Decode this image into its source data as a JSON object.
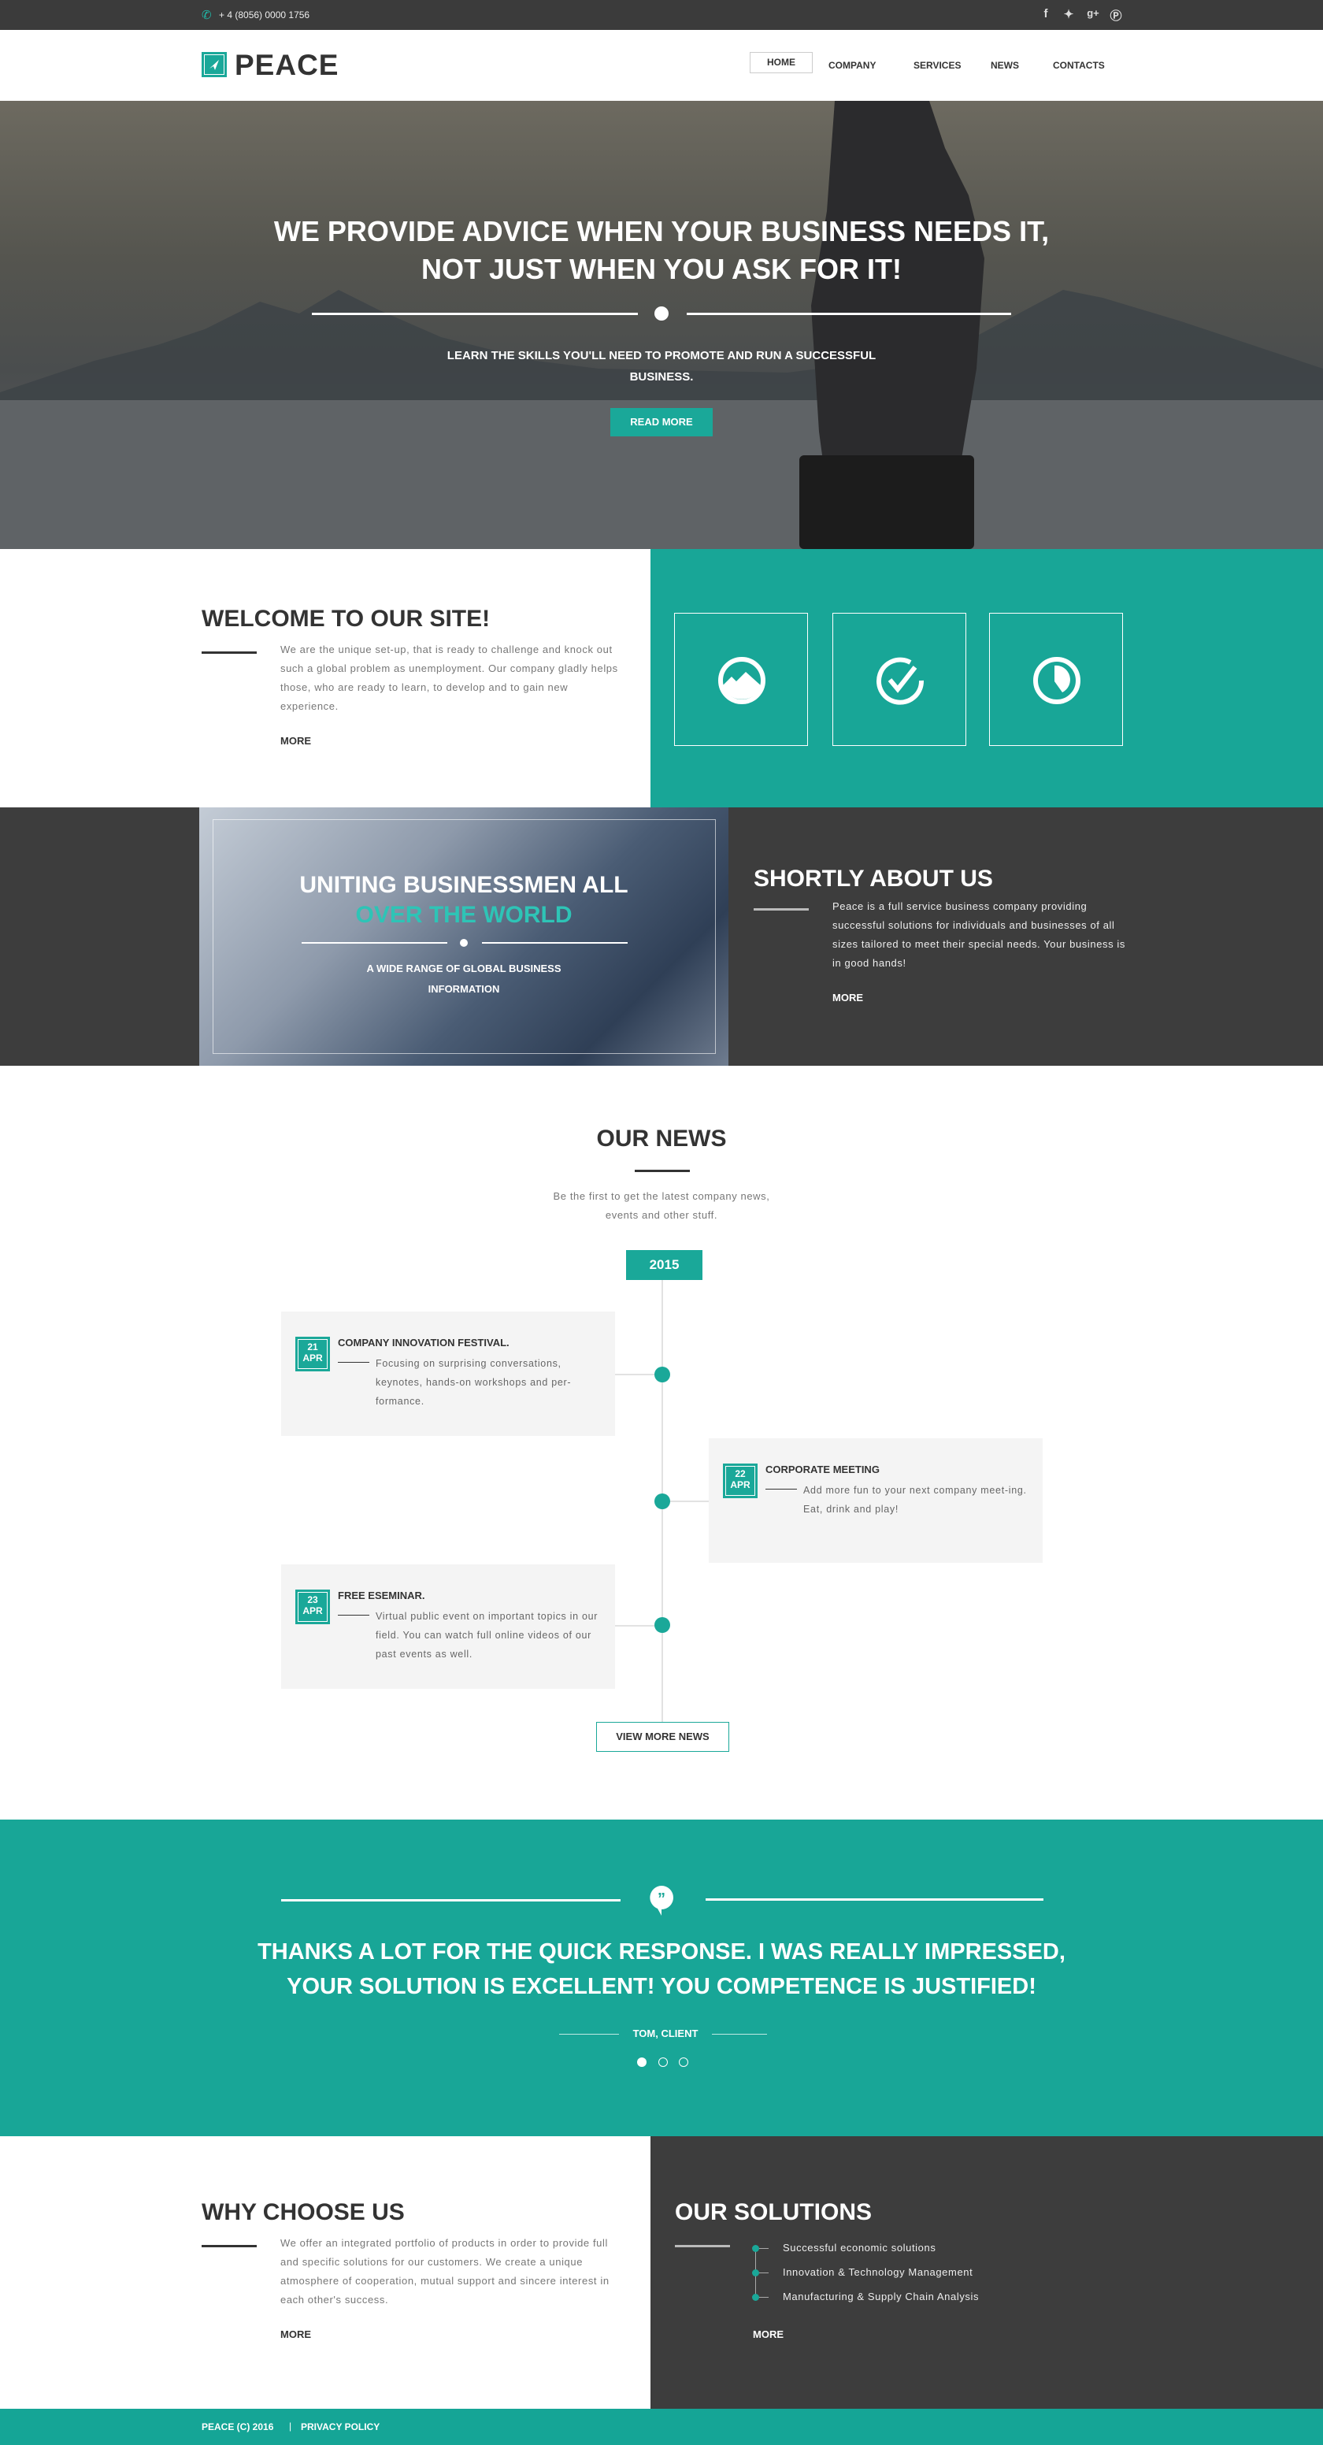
{
  "topbar": {
    "phone": "+ 4 (8056)  0000 1756",
    "social": [
      "facebook-icon",
      "twitter-icon",
      "google-plus-icon",
      "pinterest-icon"
    ]
  },
  "header": {
    "logo": "PEACE",
    "nav": [
      {
        "label": "HOME",
        "active": true
      },
      {
        "label": "COMPANY"
      },
      {
        "label": "SERVICES"
      },
      {
        "label": "NEWS"
      },
      {
        "label": "CONTACTS"
      }
    ]
  },
  "hero": {
    "title_line1": "WE PROVIDE ADVICE WHEN YOUR BUSINESS NEEDS IT,",
    "title_line2": "NOT JUST WHEN YOU ASK FOR IT!",
    "subtitle": "LEARN THE SKILLS YOU'LL NEED TO PROMOTE AND RUN A SUCCESSFUL BUSINESS.",
    "button": "READ MORE"
  },
  "welcome": {
    "title": "WELCOME TO OUR SITE!",
    "text": "We are the unique set-up, that is ready to challenge and knock out such a global problem as unemployment. Our company gladly helps those, who are ready to learn, to develop and to gain new experience.",
    "more": "MORE",
    "icons": [
      "mountain-icon",
      "check-icon",
      "clock-icon"
    ]
  },
  "about": {
    "banner_line1": "UNITING BUSINESSMEN ALL",
    "banner_line2": "OVER THE WORLD",
    "banner_sub": "A WIDE RANGE OF GLOBAL BUSINESS INFORMATION",
    "title": "SHORTLY ABOUT US",
    "text": "Peace is a full service business company providing successful solutions for individuals and businesses of all sizes tailored to meet their special needs. Your business is in good hands!",
    "more": "MORE"
  },
  "news": {
    "title": "OUR NEWS",
    "subtitle": "Be the first to get the latest company news, events and other stuff.",
    "year": "2015",
    "items": [
      {
        "day": "21",
        "month": "APR",
        "title": "COMPANY INNOVATION FESTIVAL.",
        "text": "Focusing on surprising conversations, keynotes, hands-on workshops and per-formance."
      },
      {
        "day": "22",
        "month": "APR",
        "title": "CORPORATE MEETING",
        "text": "Add more fun to your next company meet-ing. Eat, drink and play!"
      },
      {
        "day": "23",
        "month": "APR",
        "title": "FREE ESEMINAR.",
        "text": "Virtual public event on important topics in our field. You can watch full online videos of our past events as well."
      }
    ],
    "button": "VIEW MORE NEWS"
  },
  "testimonial": {
    "quote_line1": "THANKS A LOT FOR THE QUICK RESPONSE. I WAS REALLY IMPRESSED,",
    "quote_line2": "YOUR SOLUTION IS EXCELLENT! YOU COMPETENCE IS JUSTIFIED!",
    "author": "TOM, CLIENT",
    "active_slide": 1,
    "slides": 3
  },
  "why": {
    "title": "WHY CHOOSE US",
    "text": "We offer an integrated portfolio of products in order to provide full and specific solutions for our customers. We create a unique atmosphere of cooperation, mutual support and sincere interest in each other's success.",
    "more": "MORE"
  },
  "solutions": {
    "title": "OUR SOLUTIONS",
    "items": [
      "Successful economic solutions",
      "Innovation & Technology Management",
      "Manufacturing & Supply Chain Analysis"
    ],
    "more": "MORE"
  },
  "footer": {
    "copyright": "PEACE (C) 2016",
    "separator": "|",
    "privacy": "PRIVACY POLICY"
  },
  "colors": {
    "accent": "#18a697",
    "dark": "#3d3d3d",
    "highlight": "#2ec4b6"
  }
}
